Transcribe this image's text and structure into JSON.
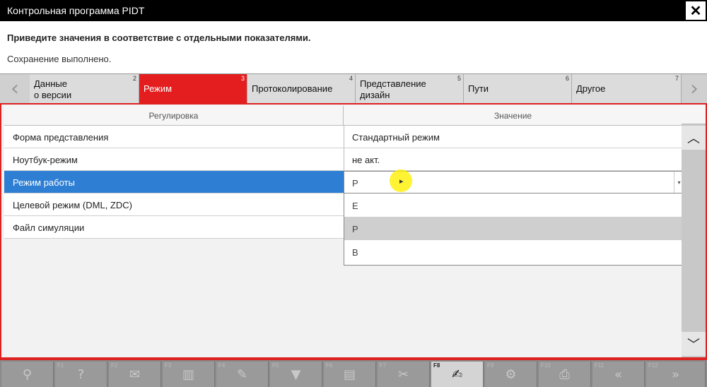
{
  "window": {
    "title": "Контрольная программа PIDT",
    "close_glyph": "✕"
  },
  "info": {
    "message": "Приведите значения в соответствие с отдельными показателями.",
    "status": "Сохранение выполнено."
  },
  "tabs": [
    {
      "line1": "Данные",
      "line2": "о версии",
      "num": "2"
    },
    {
      "line1": "Режим",
      "line2": "",
      "num": "3",
      "active": true
    },
    {
      "line1": "Протоколирование",
      "line2": "",
      "num": "4"
    },
    {
      "line1": "Представление",
      "line2": "дизайн",
      "num": "5"
    },
    {
      "line1": "Пути",
      "line2": "",
      "num": "6"
    },
    {
      "line1": "Другое",
      "line2": "",
      "num": "7"
    }
  ],
  "table": {
    "col1_header": "Регулировка",
    "col2_header": "Значение",
    "rows": [
      {
        "setting": "Форма представления",
        "value": "Стандартный режим"
      },
      {
        "setting": "Ноутбук-режим",
        "value": "не акт."
      },
      {
        "setting": "Режим работы",
        "value": "P"
      },
      {
        "setting": "Целевой режим (DML, ZDC)",
        "value": ""
      },
      {
        "setting": "Файл симуляции",
        "value": ""
      }
    ]
  },
  "dropdown": {
    "selected": "P",
    "options": [
      "E",
      "P",
      "B"
    ]
  },
  "fkeys": [
    {
      "num": "",
      "icon": "search-icon"
    },
    {
      "num": "F1",
      "icon": "help-icon",
      "glyph": "?"
    },
    {
      "num": "F2",
      "icon": "mail-icon"
    },
    {
      "num": "F3",
      "icon": "chart-icon"
    },
    {
      "num": "F4",
      "icon": "edit-icon"
    },
    {
      "num": "F5",
      "icon": "filter-icon"
    },
    {
      "num": "F6",
      "icon": "print-icon"
    },
    {
      "num": "F7",
      "icon": "tools-icon"
    },
    {
      "num": "F8",
      "icon": "notes-icon"
    },
    {
      "num": "F9",
      "icon": "gear-icon"
    },
    {
      "num": "F10",
      "icon": "printer-icon"
    },
    {
      "num": "F11",
      "icon": "rewind-icon",
      "glyph": "«"
    },
    {
      "num": "F12",
      "icon": "forward-icon",
      "glyph": "»"
    }
  ]
}
